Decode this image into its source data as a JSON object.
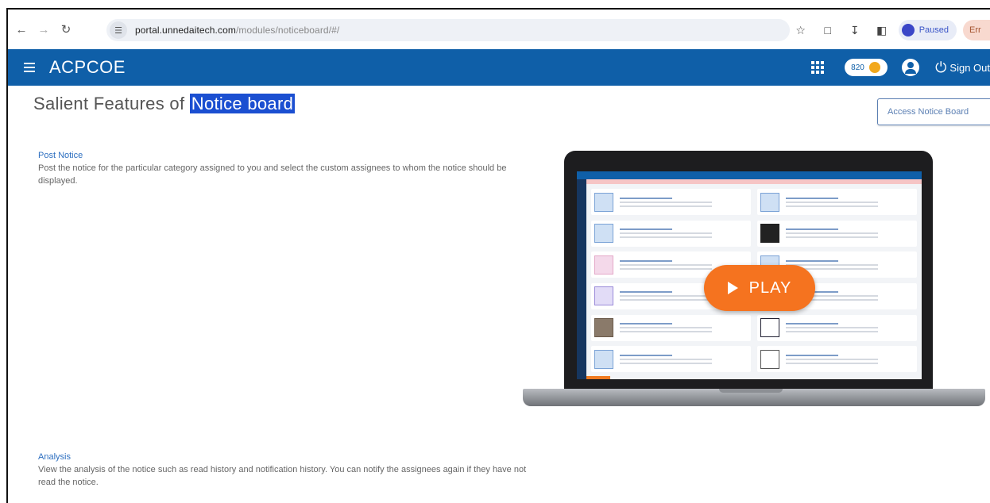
{
  "browser": {
    "url_host": "portal.unnedaitech.com",
    "url_path": "/modules/noticeboard/#/",
    "profile_status": "Paused",
    "error_badge": "Err"
  },
  "app": {
    "brand": "ACPCOE",
    "coins": "820",
    "signout": "Sign Out"
  },
  "page": {
    "title_prefix": "Salient Features of ",
    "title_highlight": "Notice board",
    "access_button": "Access Notice Board"
  },
  "features": [
    {
      "title": "Post Notice",
      "text": "Post the notice for the particular category assigned to you and select the custom assignees to whom the notice should be displayed."
    },
    {
      "title": "Analysis",
      "text": "View the analysis of the notice such as read history and notification history. You can notify the assignees again if they have not read the notice."
    }
  ],
  "video": {
    "play_label": "PLAY"
  },
  "icons": {
    "back": "arrow-left-icon",
    "forward": "arrow-right-icon",
    "reload": "reload-icon",
    "star": "star-icon",
    "apps": "grid-icon",
    "user": "user-icon",
    "power": "power-icon"
  },
  "colors": {
    "header": "#0f5fa8",
    "play_button": "#f5731f",
    "highlight": "#1b4fd1",
    "link": "#2d6fc0"
  }
}
